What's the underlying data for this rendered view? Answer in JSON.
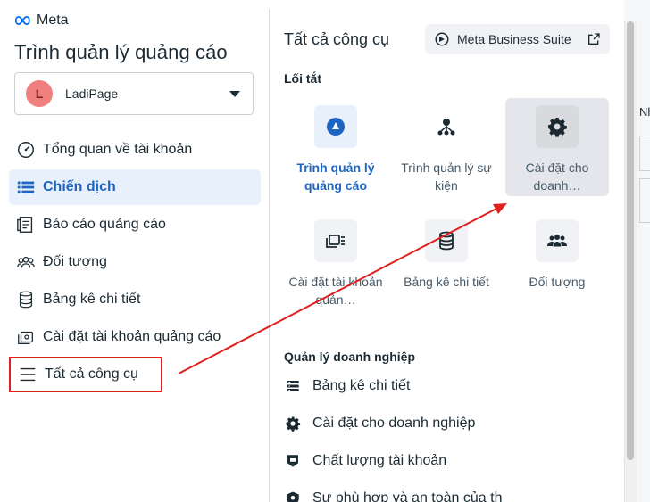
{
  "brand": {
    "logo_text": "Meta",
    "app_title": "Trình quản lý quảng cáo"
  },
  "account": {
    "avatar_letter": "L",
    "name": "LadiPage"
  },
  "nav": {
    "items": [
      {
        "label": "Tổng quan về tài khoản",
        "icon": "gauge-icon"
      },
      {
        "label": "Chiến dịch",
        "icon": "list-icon",
        "active": true
      },
      {
        "label": "Báo cáo quảng cáo",
        "icon": "report-icon"
      },
      {
        "label": "Đối tượng",
        "icon": "audience-icon"
      },
      {
        "label": "Bảng kê chi tiết",
        "icon": "billing-icon"
      },
      {
        "label": "Cài đặt tài khoản quảng cáo",
        "icon": "ad-account-settings-icon"
      },
      {
        "label": "Tất cả công cụ",
        "icon": "menu-icon",
        "highlighted": true
      }
    ]
  },
  "tools_panel": {
    "title": "Tất cả công cụ",
    "mbs_button": "Meta Business Suite",
    "shortcuts_label": "Lối tắt",
    "shortcuts": [
      {
        "label": "Trình quản lý quảng cáo",
        "icon": "ads-manager-icon",
        "primary": true
      },
      {
        "label": "Trình quản lý sự kiện",
        "icon": "events-manager-icon"
      },
      {
        "label": "Cài đặt cho doanh…",
        "icon": "gear-icon",
        "selected": true
      },
      {
        "label": "Cài đặt tài khoản quản…",
        "icon": "ad-account-settings-icon"
      },
      {
        "label": "Bảng kê chi tiết",
        "icon": "billing-icon"
      },
      {
        "label": "Đối tượng",
        "icon": "audience-icon"
      }
    ],
    "business_label": "Quản lý doanh nghiệp",
    "business_items": [
      {
        "label": "Bảng kê chi tiết",
        "icon": "billing-icon"
      },
      {
        "label": "Cài đặt cho doanh nghiệp",
        "icon": "gear-icon"
      },
      {
        "label": "Chất lượng tài khoản",
        "icon": "shield-icon"
      },
      {
        "label": "Sự phù hợp và an toàn của th",
        "icon": "safety-shield-icon"
      }
    ]
  },
  "background": {
    "partial_text": "Nh"
  },
  "colors": {
    "accent": "#1d65c1",
    "annotation": "#e02020",
    "active_bg": "#e7f0fb"
  }
}
